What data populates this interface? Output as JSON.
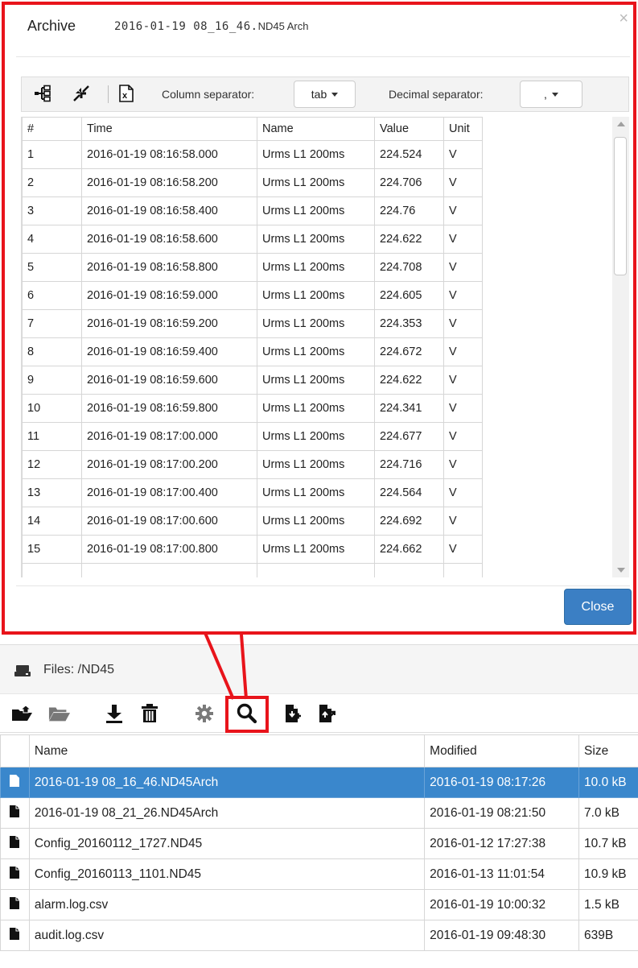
{
  "modal": {
    "title": "Archive",
    "subtitle_mono": "2016-01-19 08_16_46.",
    "subtitle_tail": "ND45 Arch",
    "close_x": "×",
    "toolbar": {
      "column_separator_label": "Column separator:",
      "column_separator_value": "tab",
      "decimal_separator_label": "Decimal separator:",
      "decimal_separator_value": ","
    },
    "grid": {
      "columns": [
        "#",
        "Time",
        "Name",
        "Value",
        "Unit"
      ],
      "rows": [
        [
          "1",
          "2016-01-19 08:16:58.000",
          "Urms L1 200ms",
          "224.524",
          "V"
        ],
        [
          "2",
          "2016-01-19 08:16:58.200",
          "Urms L1 200ms",
          "224.706",
          "V"
        ],
        [
          "3",
          "2016-01-19 08:16:58.400",
          "Urms L1 200ms",
          "224.76",
          "V"
        ],
        [
          "4",
          "2016-01-19 08:16:58.600",
          "Urms L1 200ms",
          "224.622",
          "V"
        ],
        [
          "5",
          "2016-01-19 08:16:58.800",
          "Urms L1 200ms",
          "224.708",
          "V"
        ],
        [
          "6",
          "2016-01-19 08:16:59.000",
          "Urms L1 200ms",
          "224.605",
          "V"
        ],
        [
          "7",
          "2016-01-19 08:16:59.200",
          "Urms L1 200ms",
          "224.353",
          "V"
        ],
        [
          "8",
          "2016-01-19 08:16:59.400",
          "Urms L1 200ms",
          "224.672",
          "V"
        ],
        [
          "9",
          "2016-01-19 08:16:59.600",
          "Urms L1 200ms",
          "224.622",
          "V"
        ],
        [
          "10",
          "2016-01-19 08:16:59.800",
          "Urms L1 200ms",
          "224.341",
          "V"
        ],
        [
          "11",
          "2016-01-19 08:17:00.000",
          "Urms L1 200ms",
          "224.677",
          "V"
        ],
        [
          "12",
          "2016-01-19 08:17:00.200",
          "Urms L1 200ms",
          "224.716",
          "V"
        ],
        [
          "13",
          "2016-01-19 08:17:00.400",
          "Urms L1 200ms",
          "224.564",
          "V"
        ],
        [
          "14",
          "2016-01-19 08:17:00.600",
          "Urms L1 200ms",
          "224.692",
          "V"
        ],
        [
          "15",
          "2016-01-19 08:17:00.800",
          "Urms L1 200ms",
          "224.662",
          "V"
        ]
      ]
    },
    "close_button": "Close"
  },
  "files": {
    "heading": "Files: /ND45",
    "toolbar_icons": [
      "folder-upload-icon",
      "folder-open-icon",
      "download-icon",
      "trash-icon",
      "gear-icon",
      "search-icon",
      "file-import-icon",
      "file-export-icon"
    ],
    "columns": [
      "Name",
      "Modified",
      "Size"
    ],
    "rows": [
      {
        "name": "2016-01-19 08_16_46.ND45Arch",
        "modified": "2016-01-19 08:17:26",
        "size": "10.0 kB",
        "selected": true
      },
      {
        "name": "2016-01-19 08_21_26.ND45Arch",
        "modified": "2016-01-19 08:21:50",
        "size": "7.0 kB",
        "selected": false
      },
      {
        "name": "Config_20160112_1727.ND45",
        "modified": "2016-01-12 17:27:38",
        "size": "10.7 kB",
        "selected": false
      },
      {
        "name": "Config_20160113_1101.ND45",
        "modified": "2016-01-13 11:01:54",
        "size": "10.9 kB",
        "selected": false
      },
      {
        "name": "alarm.log.csv",
        "modified": "2016-01-19 10:00:32",
        "size": "1.5 kB",
        "selected": false
      },
      {
        "name": "audit.log.csv",
        "modified": "2016-01-19 09:48:30",
        "size": "639B",
        "selected": false
      }
    ]
  },
  "colors": {
    "highlight": "#e8141b",
    "selected_row": "#3a87cc",
    "close_button": "#3b7fc4"
  }
}
